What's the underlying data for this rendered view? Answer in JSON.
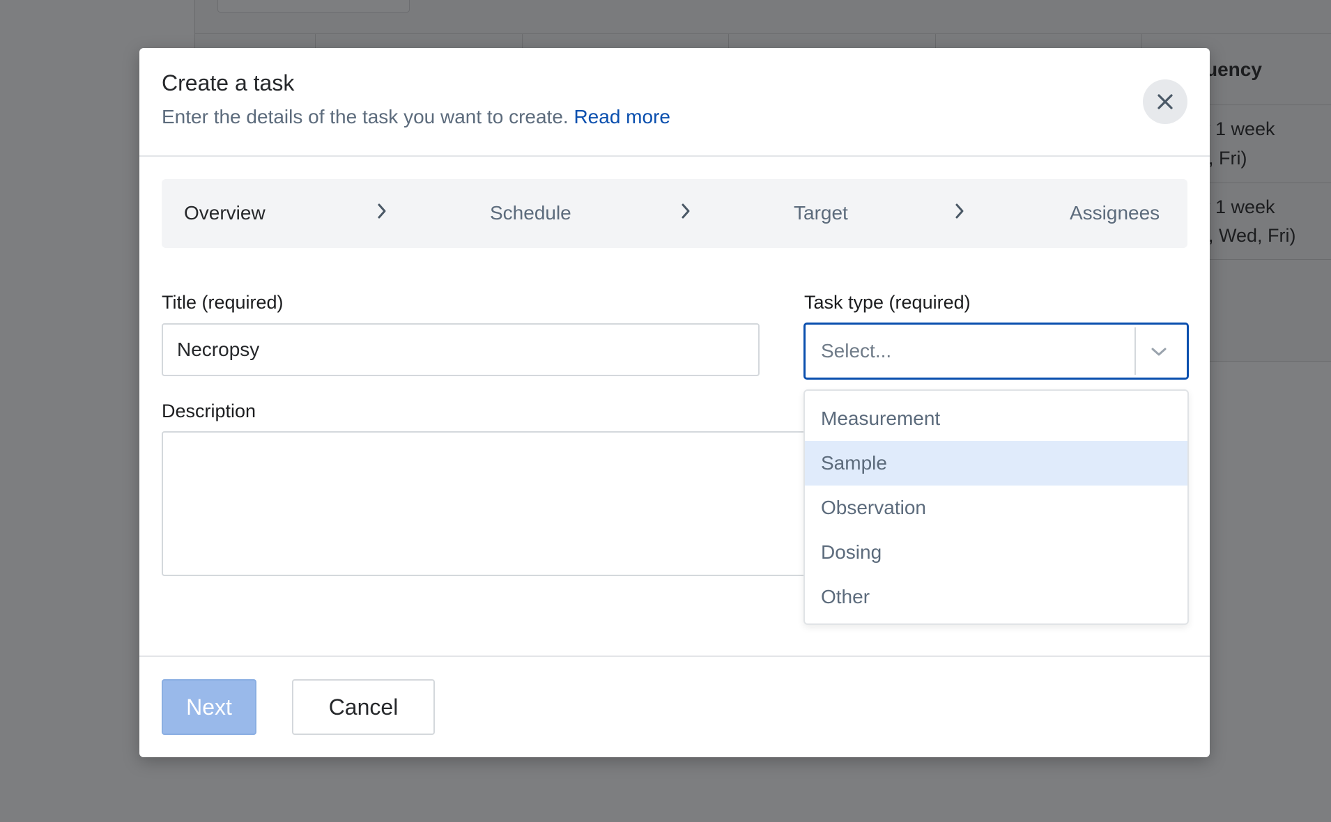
{
  "background": {
    "column_header": "uency",
    "rows": [
      {
        "line1": "y 1 week",
        "line2": ", Fri)"
      },
      {
        "line1": "y 1 week",
        "line2": ", Wed, Fri)"
      }
    ]
  },
  "modal": {
    "title": "Create a task",
    "subtitle": "Enter the details of the task you want to create.",
    "read_more": "Read more",
    "close_icon": "close-icon"
  },
  "stepper": {
    "steps": [
      {
        "label": "Overview",
        "active": true
      },
      {
        "label": "Schedule",
        "active": false
      },
      {
        "label": "Target",
        "active": false
      },
      {
        "label": "Assignees",
        "active": false
      }
    ]
  },
  "form": {
    "title_label": "Title (required)",
    "title_value": "Necropsy",
    "task_type_label": "Task type (required)",
    "task_type_placeholder": "Select...",
    "description_label": "Description",
    "description_value": "",
    "task_type_options": [
      "Measurement",
      "Sample",
      "Observation",
      "Dosing",
      "Other"
    ],
    "highlighted_option": "Sample"
  },
  "footer": {
    "next_label": "Next",
    "cancel_label": "Cancel"
  },
  "colors": {
    "link": "#0a4fae",
    "focus_border": "#0a4fae",
    "option_highlight": "#e0ebfb",
    "next_disabled": "#99b9ea"
  }
}
